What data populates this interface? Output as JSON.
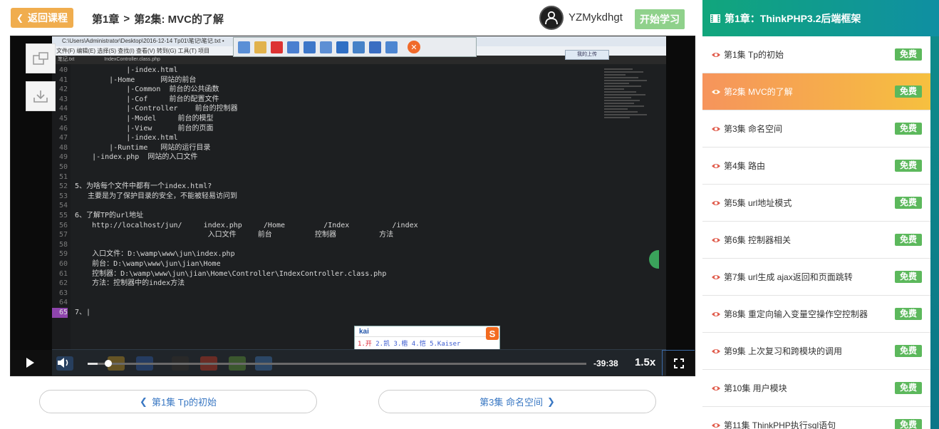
{
  "header": {
    "back_label": "返回课程",
    "chapter": "第1章",
    "episode": "第2集: MVC的了解",
    "username": "YZMykdhgt",
    "start_label": "开始学习"
  },
  "video": {
    "window_title": "C:\\Users\\Administrator\\Desktop\\2016-12-14 Tp01\\笔记\\笔记.txt •",
    "menu": "文件(F)  编辑(E)  选择(S)  查找(I)  查看(V)  转到(G)  工具(T)  项目",
    "tabs": [
      "笔记.txt",
      "IndexController.class.php"
    ],
    "cloud_label": "我的上传",
    "code_lines": [
      {
        "n": "40",
        "t": "            |-index.html"
      },
      {
        "n": "41",
        "t": "        |-Home      网站的前台"
      },
      {
        "n": "42",
        "t": "            |-Common  前台的公共函数"
      },
      {
        "n": "43",
        "t": "            |-Cof     前台的配置文件"
      },
      {
        "n": "44",
        "t": "            |-Controller    前台的控制器"
      },
      {
        "n": "45",
        "t": "            |-Model     前台的模型"
      },
      {
        "n": "46",
        "t": "            |-View      前台的页面"
      },
      {
        "n": "47",
        "t": "            |-index.html"
      },
      {
        "n": "48",
        "t": "        |-Runtime   网站的运行目录"
      },
      {
        "n": "49",
        "t": "    |-index.php  网站的入口文件"
      },
      {
        "n": "50",
        "t": ""
      },
      {
        "n": "51",
        "t": ""
      },
      {
        "n": "52",
        "t": "5、为啥每个文件中都有一个index.html?"
      },
      {
        "n": "53",
        "t": "   主要是为了保护目录的安全，不能被轻易访问到"
      },
      {
        "n": "54",
        "t": ""
      },
      {
        "n": "55",
        "t": "6、了解TP的url地址"
      },
      {
        "n": "56",
        "t": "    http://localhost/jun/     index.php     /Home         /Index          /index"
      },
      {
        "n": "57",
        "t": "                               入口文件     前台          控制器          方法"
      },
      {
        "n": "58",
        "t": ""
      },
      {
        "n": "59",
        "t": "    入口文件：D:\\wamp\\www\\jun\\index.php"
      },
      {
        "n": "60",
        "t": "    前台：D:\\wamp\\www\\jun\\jian\\Home"
      },
      {
        "n": "61",
        "t": "    控制器：D:\\wamp\\www\\jun\\jian\\Home\\Controller\\IndexController.class.php"
      },
      {
        "n": "62",
        "t": "    方法：控制器中的index方法"
      },
      {
        "n": "63",
        "t": ""
      },
      {
        "n": "64",
        "t": ""
      },
      {
        "n": "65",
        "t": "7、|"
      }
    ],
    "ime": {
      "query": "kai",
      "candidates": [
        "1.开",
        "2.凯",
        "3.楷",
        "4.恺",
        "5.Kaiser"
      ],
      "logo": "S"
    },
    "time_remaining": "-39:38",
    "speed": "1.5x",
    "progress": 0.02
  },
  "nav": {
    "prev_label": "第1集 Tp的初始",
    "next_label": "第3集 命名空间"
  },
  "sidebar": {
    "title": "第1章：ThinkPHP3.2后端框架",
    "badge_label": "免费",
    "active_index": 1,
    "items": [
      {
        "label": "第1集 Tp的初始"
      },
      {
        "label": "第2集 MVC的了解"
      },
      {
        "label": "第3集 命名空间"
      },
      {
        "label": "第4集 路由"
      },
      {
        "label": "第5集 url地址模式"
      },
      {
        "label": "第6集 控制器相关"
      },
      {
        "label": "第7集 url生成 ajax返回和页面跳转"
      },
      {
        "label": "第8集 重定向输入变量空操作空控制器"
      },
      {
        "label": "第9集 上次复习和跨模块的调用"
      },
      {
        "label": "第10集 用户模块"
      },
      {
        "label": "第11集 ThinkPHP执行sql语句"
      }
    ]
  },
  "colors": {
    "accent_orange": "#f0ad4e",
    "badge_green": "#5cb85c",
    "sidebar_header": "#11a67c",
    "active_item": "#f6945c",
    "link_blue": "#3a78c3"
  }
}
